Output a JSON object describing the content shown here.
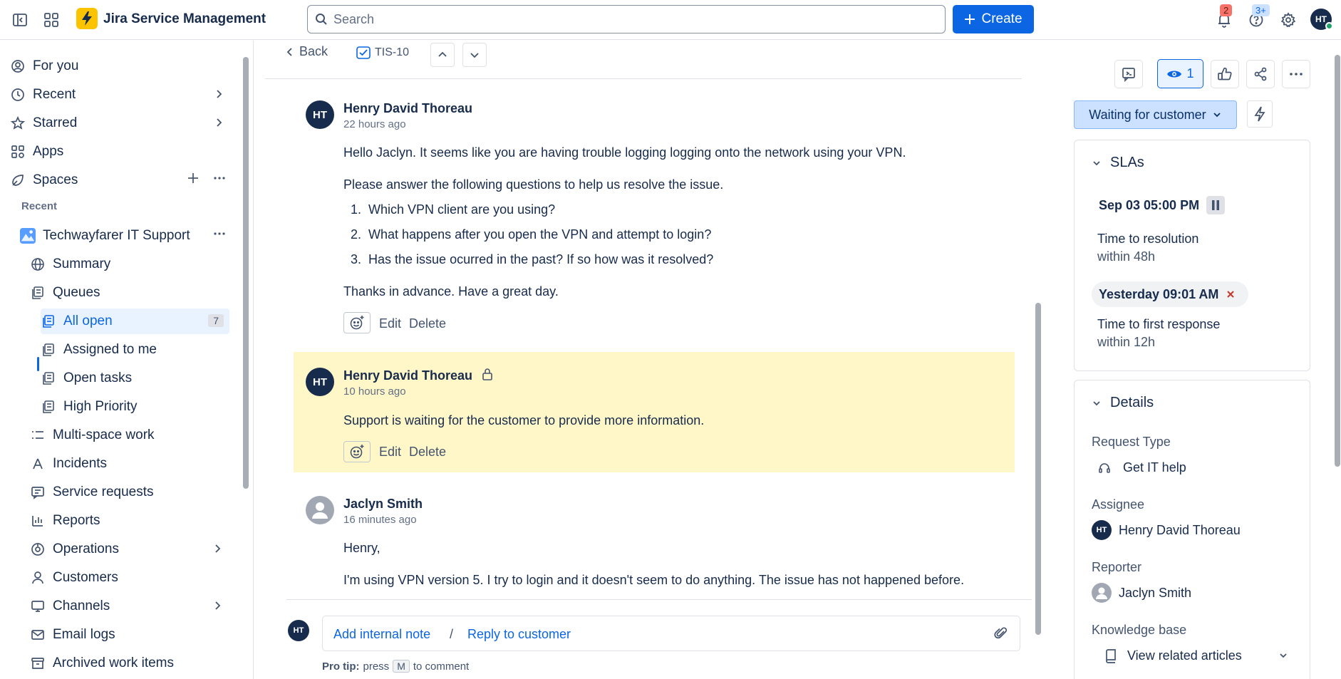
{
  "topbar": {
    "app_title": "Jira Service Management",
    "search_placeholder": "Search",
    "create_label": "Create",
    "notifications_count": "2",
    "help_count": "3+",
    "user_initials": "HT"
  },
  "sidebar": {
    "items": {
      "for_you": "For you",
      "recent": "Recent",
      "starred": "Starred",
      "apps": "Apps",
      "spaces": "Spaces"
    },
    "recent_heading": "Recent",
    "project": "Techwayfarer IT Support",
    "project_items": {
      "summary": "Summary",
      "queues": "Queues",
      "all_open": "All open",
      "all_open_count": "7",
      "assigned_to_me": "Assigned to me",
      "open_tasks": "Open tasks",
      "high_priority": "High Priority",
      "multi_space": "Multi-space work",
      "incidents": "Incidents",
      "service_requests": "Service requests",
      "reports": "Reports",
      "operations": "Operations",
      "customers": "Customers",
      "channels": "Channels",
      "email_logs": "Email logs",
      "archived": "Archived work items"
    }
  },
  "issue_nav": {
    "back_label": "Back",
    "issue_key": "TIS-10"
  },
  "comments": [
    {
      "initials": "HT",
      "author": "Henry David Thoreau",
      "time": "22 hours ago",
      "greeting": "Hello Jaclyn. It seems like you are having trouble logging logging onto the network using your VPN.",
      "intro": "Please answer the following questions to help us resolve the issue.",
      "questions": [
        "Which VPN client are you using?",
        "What happens after you open the VPN and attempt to login?",
        "Has the issue ocurred in the past? If so how was it resolved?"
      ],
      "closing": "Thanks in advance. Have a great day.",
      "edit": "Edit",
      "delete": "Delete"
    },
    {
      "initials": "HT",
      "author": "Henry David Thoreau",
      "time": "10 hours ago",
      "body": "Support is waiting for the customer to provide more information.",
      "edit": "Edit",
      "delete": "Delete"
    },
    {
      "author": "Jaclyn Smith",
      "time": "16 minutes ago",
      "greeting": "Henry,",
      "body": "I'm using VPN version 5. I try to login and it doesn't seem to do anything. The issue has not happened before."
    }
  ],
  "reply": {
    "initials": "HT",
    "internal_note": "Add internal note",
    "separator": "/",
    "reply_customer": "Reply to customer",
    "pro_tip_label": "Pro tip:",
    "pro_tip_press": "press",
    "pro_tip_key": "M",
    "pro_tip_suffix": "to comment"
  },
  "right_panel": {
    "watchers_count": "1",
    "status": "Waiting for customer",
    "slas": {
      "title": "SLAs",
      "items": [
        {
          "due": "Sep 03 05:00 PM",
          "name": "Time to resolution",
          "goal": "within 48h"
        },
        {
          "due": "Yesterday 09:01 AM",
          "name": "Time to first response",
          "goal": "within 12h"
        }
      ]
    },
    "details": {
      "title": "Details",
      "request_type_label": "Request Type",
      "request_type": "Get IT help",
      "assignee_label": "Assignee",
      "assignee_initials": "HT",
      "assignee": "Henry David Thoreau",
      "reporter_label": "Reporter",
      "reporter": "Jaclyn Smith",
      "kb_label": "Knowledge base",
      "kb_value": "View related articles"
    }
  },
  "colors": {
    "accent": "#0c66e4",
    "internal_note_bg": "#fff7c8",
    "status_bg": "#cce0ff",
    "breach_red": "#c9372c"
  }
}
